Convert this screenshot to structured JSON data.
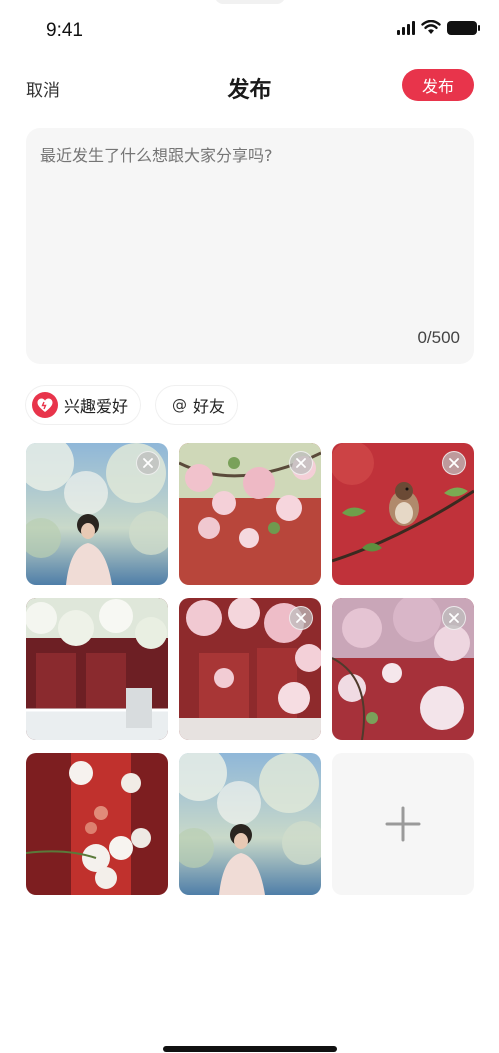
{
  "status": {
    "time": "9:41"
  },
  "nav": {
    "cancel": "取消",
    "title": "发布",
    "publish": "发布"
  },
  "composer": {
    "placeholder": "最近发生了什么想跟大家分享吗?",
    "counter": "0/500"
  },
  "chips": [
    {
      "label": "兴趣爱好",
      "icon": "heart-icon"
    },
    {
      "label": "好友",
      "icon": "at-icon",
      "symbol": "@"
    }
  ],
  "photos": [
    {
      "subject": "woman under blossoms",
      "removable": true
    },
    {
      "subject": "pink blossoms on red wall",
      "removable": true
    },
    {
      "subject": "sparrow on branch",
      "removable": true
    },
    {
      "subject": "palace gate with blossoms",
      "removable": false
    },
    {
      "subject": "blossoms by red gate",
      "removable": true
    },
    {
      "subject": "close-up blossoms",
      "removable": true
    },
    {
      "subject": "blossoms by red pillar",
      "removable": false
    },
    {
      "subject": "woman under blossoms",
      "removable": false
    }
  ],
  "add_tile": {
    "icon": "plus-icon"
  },
  "colors": {
    "accent": "#e8344b",
    "surface": "#f6f6f6"
  }
}
